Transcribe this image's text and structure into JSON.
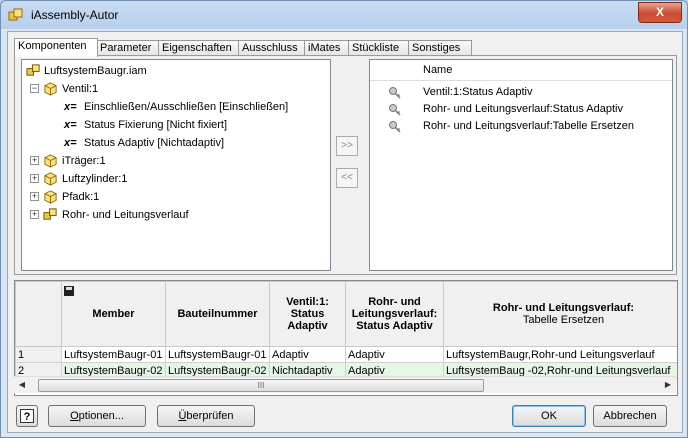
{
  "window": {
    "title": "iAssembly-Autor",
    "close_label": "X"
  },
  "tabs": [
    {
      "label": "Komponenten",
      "active": true
    },
    {
      "label": "Parameter"
    },
    {
      "label": "Eigenschaften"
    },
    {
      "label": "Ausschluss"
    },
    {
      "label": "iMates"
    },
    {
      "label": "Stückliste"
    },
    {
      "label": "Sonstiges"
    }
  ],
  "tree": {
    "root": "LuftsystemBaugr.iam",
    "items": [
      {
        "label": "Ventil:1",
        "expander": "−"
      },
      {
        "label": "Einschließen/Ausschließen [Einschließen]"
      },
      {
        "label": "Status Fixierung [Nicht fixiert]"
      },
      {
        "label": "Status Adaptiv [Nichtadaptiv]"
      },
      {
        "label": "iTräger:1",
        "expander": "+"
      },
      {
        "label": "Luftzylinder:1",
        "expander": "+"
      },
      {
        "label": "Pfadk:1",
        "expander": "+"
      },
      {
        "label": "Rohr- und Leitungsverlauf",
        "expander": "+"
      }
    ]
  },
  "transfer": {
    "add": ">>",
    "remove": "<<"
  },
  "right_list": {
    "header": "Name",
    "items": [
      "Ventil:1:Status Adaptiv",
      "Rohr- und Leitungsverlauf:Status Adaptiv",
      "Rohr- und Leitungsverlauf:Tabelle Ersetzen"
    ]
  },
  "table": {
    "headers": {
      "member": "Member",
      "part_number": "Bauteilnummer",
      "col3_l1": "Ventil:1:",
      "col3_l2": "Status",
      "col3_l3": "Adaptiv",
      "col4_l1": "Rohr- und",
      "col4_l2": "Leitungsverlauf:",
      "col4_l3": "Status Adaptiv",
      "col5_l1": "Rohr- und Leitungsverlauf:",
      "col5_l2": "Tabelle Ersetzen"
    },
    "rows": [
      {
        "num": "1",
        "member": "LuftsystemBaugr-01",
        "part": "LuftsystemBaugr-01",
        "ventil": "Adaptiv",
        "rohr_status": "Adaptiv",
        "rohr_table": "LuftsystemBaugr,Rohr-und Leitungsverlauf"
      },
      {
        "num": "2",
        "member": "LuftsystemBaugr-02",
        "part": "LuftsystemBaugr-02",
        "ventil": "Nichtadaptiv",
        "rohr_status": "Adaptiv",
        "rohr_table": "LuftsystemBaug -02,Rohr-und Leitungsverlauf"
      }
    ],
    "scroll_grip": "III"
  },
  "buttons": {
    "options_u": "O",
    "options_rest": "ptionen...",
    "check_u": "Ü",
    "check_rest": "berprüfen",
    "ok": "OK",
    "cancel": "Abbrechen"
  }
}
